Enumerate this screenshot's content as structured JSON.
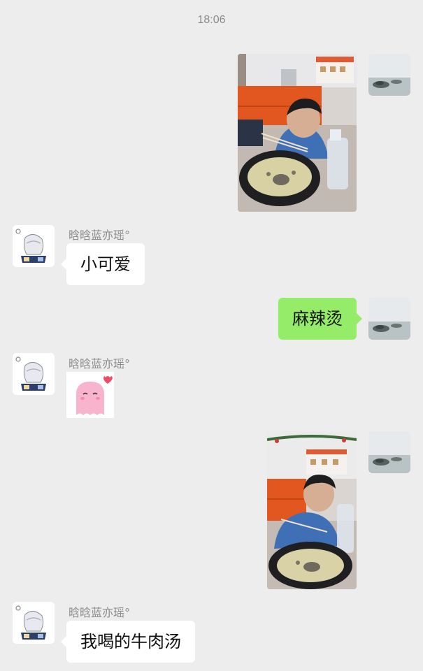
{
  "timestamp": "18:06",
  "contact_name": "晗晗蓝亦瑶°",
  "messages": [
    {
      "type": "image",
      "from": "self"
    },
    {
      "type": "text",
      "from": "other",
      "sender": "晗晗蓝亦瑶°",
      "text": "小可爱"
    },
    {
      "type": "text",
      "from": "self",
      "text": "麻辣烫"
    },
    {
      "type": "sticker",
      "from": "other",
      "sender": "晗晗蓝亦瑶°"
    },
    {
      "type": "image",
      "from": "self"
    },
    {
      "type": "text",
      "from": "other",
      "sender": "晗晗蓝亦瑶°",
      "text": "我喝的牛肉汤"
    }
  ],
  "colors": {
    "background": "#ededed",
    "outgoing_bubble": "#95ec69",
    "incoming_bubble": "#ffffff",
    "timestamp_text": "#8a8a8a",
    "name_text": "#8c8c8c"
  }
}
